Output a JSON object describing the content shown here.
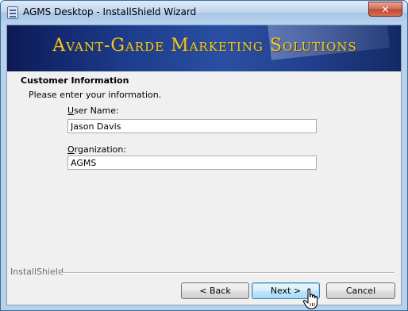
{
  "window": {
    "title": "AGMS Desktop - InstallShield Wizard",
    "close_glyph": "✕"
  },
  "banner": {
    "text": "Avant-Garde Marketing Solutions"
  },
  "section": {
    "title": "Customer Information",
    "subtitle": "Please enter your information."
  },
  "form": {
    "username_label_accel": "U",
    "username_label_rest": "ser Name:",
    "username_value": "Jason Davis",
    "organization_label_accel": "O",
    "organization_label_rest": "rganization:",
    "organization_value": "AGMS"
  },
  "footer": {
    "brand": "InstallShield",
    "back_label": "< Back",
    "next_label": "Next >",
    "cancel_label": "Cancel"
  },
  "icons": [
    "app-icon",
    "close-icon",
    "hand-cursor-icon"
  ],
  "colors": {
    "banner_text": "#e8c843",
    "banner_bg": "#1d3c8c",
    "close_button": "#c24a30"
  }
}
